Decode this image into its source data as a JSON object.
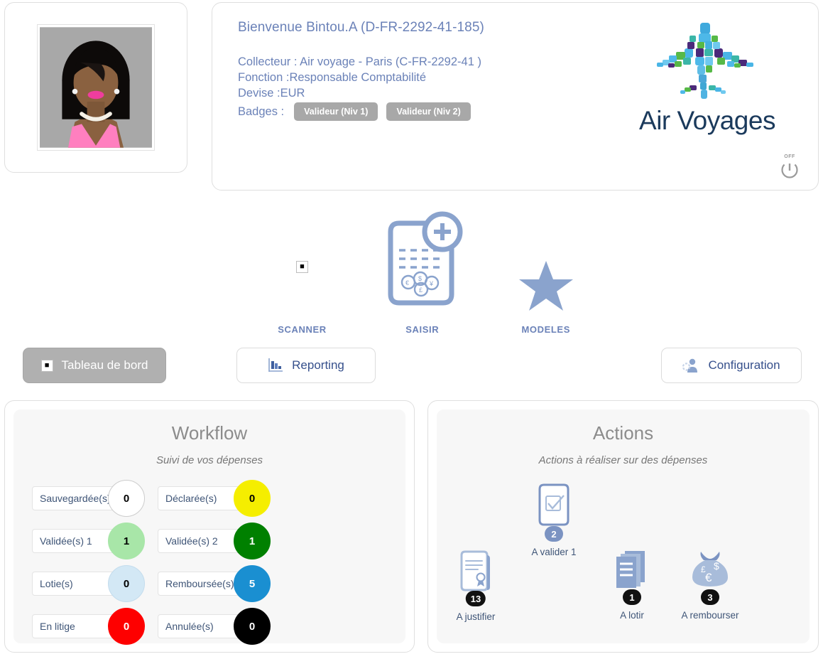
{
  "profile": {
    "avatar_alt": "user-avatar-photo",
    "welcome": "Bienvenue Bintou.A (D-FR-2292-41-185)",
    "collecteur": "Collecteur : Air voyage - Paris (C-FR-2292-41 )",
    "fonction": "Fonction :Responsable Comptabilité",
    "devise": "Devise :EUR",
    "badges_label": "Badges :",
    "badges": [
      "Valideur (Niv 1)",
      "Valideur (Niv 2)"
    ]
  },
  "brand": {
    "name": "Air Voyages",
    "logo_icon": "airplane-mosaic-logo"
  },
  "power": {
    "label": "OFF",
    "icon": "power-icon"
  },
  "quick_actions": [
    {
      "label": "SCANNER",
      "icon": "broken-image-icon"
    },
    {
      "label": "SAISIR",
      "icon": "new-expense-document-icon"
    },
    {
      "label": "MODELES",
      "icon": "star-icon"
    }
  ],
  "nav": [
    {
      "id": "dashboard",
      "label": "Tableau de bord",
      "icon": "broken-image-icon",
      "active": true
    },
    {
      "id": "reporting",
      "label": "Reporting",
      "icon": "bar-chart-icon",
      "active": false
    },
    {
      "id": "configuration",
      "label": "Configuration",
      "icon": "user-gear-icon",
      "active": false
    }
  ],
  "workflow": {
    "title": "Workflow",
    "subtitle": "Suivi de vos dépenses",
    "items": [
      {
        "label": "Sauvegardée(s)",
        "count": "0",
        "color": "#ffffff",
        "text_color": "#000000",
        "border": "#cccccc"
      },
      {
        "label": "Déclarée(s)",
        "count": "0",
        "color": "#f5ee00",
        "text_color": "#000000",
        "border": "#f5ee00"
      },
      {
        "label": "Validée(s) 1",
        "count": "1",
        "color": "#a8e6a8",
        "text_color": "#000000",
        "border": "#a8e6a8"
      },
      {
        "label": "Validée(s) 2",
        "count": "1",
        "color": "#008000",
        "text_color": "#ffffff",
        "border": "#008000"
      },
      {
        "label": "Lotie(s)",
        "count": "0",
        "color": "#d3e8f5",
        "text_color": "#000000",
        "border": "#c3dced"
      },
      {
        "label": "Remboursée(s)",
        "count": "5",
        "color": "#1a8fd1",
        "text_color": "#ffffff",
        "border": "#1a8fd1"
      },
      {
        "label": "En litige",
        "count": "0",
        "color": "#fe0000",
        "text_color": "#ffffff",
        "border": "#fe0000"
      },
      {
        "label": "Annulée(s)",
        "count": "0",
        "color": "#000000",
        "text_color": "#ffffff",
        "border": "#000000"
      }
    ]
  },
  "actions": {
    "title": "Actions",
    "subtitle": "Actions à réaliser sur des dépenses",
    "items": [
      {
        "id": "valider",
        "label": "A valider 1",
        "count": "2",
        "badge_color": "#7b93c2",
        "icon": "checkbox-document-icon"
      },
      {
        "id": "justifier",
        "label": "A justifier",
        "count": "13",
        "badge_color": "#111111",
        "icon": "certificate-document-icon"
      },
      {
        "id": "lotir",
        "label": "A lotir",
        "count": "1",
        "badge_color": "#111111",
        "icon": "stacked-documents-icon"
      },
      {
        "id": "rembourser",
        "label": "A rembourser",
        "count": "3",
        "badge_color": "#111111",
        "icon": "money-bag-icon"
      }
    ]
  },
  "colors": {
    "accent_blue": "#7b93c2",
    "text_blue": "#6b82b8",
    "panel_bg": "#f7f7f7",
    "active_nav": "#b0b0b0"
  }
}
